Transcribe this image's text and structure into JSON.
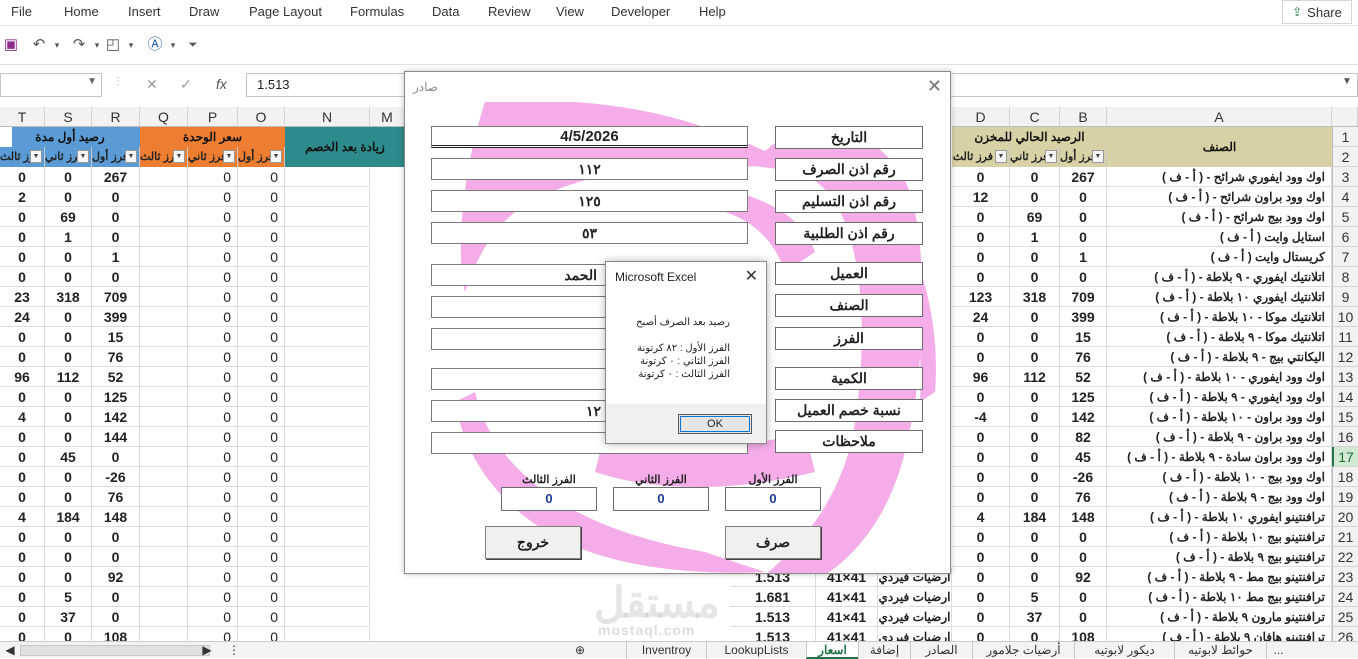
{
  "ribbon": {
    "tabs": [
      "File",
      "Home",
      "Insert",
      "Draw",
      "Page Layout",
      "Formulas",
      "Data",
      "Review",
      "View",
      "Developer",
      "Help"
    ],
    "share_label": "Share"
  },
  "formula_bar": {
    "name_box": "",
    "fx": "fx",
    "value": "1.513"
  },
  "columns_left": [
    "T",
    "S",
    "R",
    "Q",
    "P",
    "O",
    "N",
    "M"
  ],
  "columns_right": [
    "D",
    "C",
    "B",
    "A"
  ],
  "rows": [
    "1",
    "2",
    "3",
    "4",
    "5",
    "6",
    "7",
    "8",
    "9",
    "10",
    "11",
    "12",
    "13",
    "14",
    "15",
    "16",
    "17",
    "18",
    "19",
    "20",
    "21",
    "22",
    "23",
    "24",
    "25",
    "26"
  ],
  "active_row": "17",
  "headers": {
    "opening_balance": "رصيد أول مدة",
    "unit_price": "سعر الوحدة",
    "increase": "زيادة بعد الخصم",
    "increase_n": "زيادة بعد الخصم",
    "current_balance": "الرصيد الحالي للمخزن",
    "item": "الصنف",
    "sort1": "فرز أول",
    "sort2": "فرز ثاني",
    "sort3": "فرز ثالث"
  },
  "items": [
    "اوك وود ايفوري شرائح - ( أ - ف )",
    "اوك وود براون شرائح - ( أ - ف )",
    "اوك وود بيج شرائح - ( أ - ف )",
    "استايل وايت ( أ - ف )",
    "كريستال وايت ( أ - ف )",
    "اتلانتيك ايفوري - ٩ بلاطة - ( أ - ف )",
    "اتلانتيك ايفوري ١٠ بلاطة - ( أ - ف )",
    "اتلانتيك موكا - ١٠ بلاطة - ( أ - ف )",
    "اتلانتيك موكا - ٩ بلاطة - ( أ - ف )",
    "اليكانتي بيج - ٩ بلاطة - ( أ - ف )",
    "اوك وود ايفوري - ١٠ بلاطة - ( أ - ف )",
    "اوك وود ايفوري - ٩ بلاطة - ( أ - ف )",
    "اوك وود براون - ١٠ بلاطة - ( أ - ف )",
    "اوك وود براون - ٩ بلاطة - ( أ - ف )",
    "اوك وود براون سادة - ٩ بلاطة - ( أ - ف )",
    "اوك وود بيج - ١٠ بلاطة - ( أ - ف )",
    "اوك وود بيج - ٩ بلاطة - ( أ - ف )",
    "ترافنتينو ايفوري ١٠ بلاطة - ( أ - ف )",
    "ترافنتينو بيج ١٠ بلاطة - ( أ - ف )",
    "ترافنتينو بيج ٩ بلاطة - ( أ - ف )",
    "ترافنتينو بيج مط - ٩ بلاطة - ( أ - ف )",
    "ترافنتينو بيج مط ١٠ بلاطة - ( أ - ف )",
    "ترافنتينو مارون ٩ بلاطة - ( أ - ف )",
    "ترافنتينو هافان ٩ بلاطة - ( أ - ف )"
  ],
  "col_B": [
    "267",
    "0",
    "0",
    "0",
    "1",
    "0",
    "709",
    "399",
    "15",
    "76",
    "52",
    "125",
    "142",
    "82",
    "45",
    "-26",
    "76",
    "148",
    "0",
    "0",
    "92",
    "0",
    "0",
    "108"
  ],
  "col_C": [
    "0",
    "0",
    "69",
    "1",
    "0",
    "0",
    "318",
    "0",
    "0",
    "0",
    "112",
    "0",
    "0",
    "0",
    "0",
    "0",
    "0",
    "184",
    "0",
    "0",
    "0",
    "5",
    "37",
    "0"
  ],
  "col_D": [
    "0",
    "12",
    "0",
    "0",
    "0",
    "0",
    "123",
    "24",
    "0",
    "0",
    "96",
    "0",
    "-4",
    "0",
    "0",
    "0",
    "0",
    "4",
    "0",
    "0",
    "0",
    "0",
    "0",
    "0"
  ],
  "col_R": [
    "267",
    "0",
    "0",
    "0",
    "1",
    "0",
    "709",
    "399",
    "15",
    "76",
    "52",
    "125",
    "142",
    "144",
    "0",
    "-26",
    "76",
    "148",
    "0",
    "0",
    "92",
    "0",
    "0",
    "108"
  ],
  "col_S": [
    "0",
    "0",
    "69",
    "1",
    "0",
    "0",
    "318",
    "0",
    "0",
    "0",
    "112",
    "0",
    "0",
    "0",
    "45",
    "0",
    "0",
    "184",
    "0",
    "0",
    "0",
    "5",
    "37",
    "0"
  ],
  "col_T": [
    "0",
    "2",
    "0",
    "0",
    "0",
    "0",
    "23",
    "24",
    "0",
    "0",
    "96",
    "0",
    "4",
    "0",
    "0",
    "0",
    "0",
    "4",
    "0",
    "0",
    "0",
    "0",
    "0",
    "0"
  ],
  "col_P": [
    "0",
    "0",
    "0",
    "0",
    "0",
    "0",
    "0",
    "0",
    "0",
    "0",
    "0",
    "0",
    "0",
    "0",
    "0",
    "0",
    "0",
    "0",
    "0",
    "0",
    "0",
    "0",
    "0",
    "0"
  ],
  "col_O": [
    "0",
    "0",
    "0",
    "0",
    "0",
    "0",
    "0",
    "0",
    "0",
    "0",
    "0",
    "0",
    "0",
    "0",
    "0",
    "0",
    "0",
    "0",
    "0",
    "0",
    "0",
    "0",
    "0",
    "0"
  ],
  "bottom_rows": [
    {
      "price": "1.513",
      "size": "41×41",
      "type": "ارضيات فيردي"
    },
    {
      "price": "1.681",
      "size": "41×41",
      "type": "ارضيات فيردي"
    },
    {
      "price": "1.513",
      "size": "41×41",
      "type": "ارضيات فيردي"
    },
    {
      "price": "1.513",
      "size": "41×41",
      "type": "ارضيات فيردي"
    }
  ],
  "sheet_tabs": [
    "Inventroy",
    "LookupLists",
    "اسعار",
    "إضافة",
    "الصادر",
    "أرضيات جلامور",
    "ديكور لابوتيه",
    "حوائط لابوتيه",
    "..."
  ],
  "active_sheet": "اسعار",
  "form": {
    "title": "صادر",
    "labels": {
      "date": "التاريخ",
      "issue_no": "رقم اذن الصرف",
      "delivery_no": "رقم اذن التسليم",
      "request_no": "رقم اذن الطلبية",
      "customer": "العميل",
      "item": "الصنف",
      "sort": "الفرز",
      "quantity": "الكمية",
      "discount": "نسبة خصم العميل",
      "notes": "ملاحظات"
    },
    "values": {
      "date": "4/5/2026",
      "issue_no": "١١٢",
      "delivery_no": "١٢٥",
      "request_no": "٥٣",
      "customer": "الحمد",
      "item": "",
      "sort": "",
      "quantity": "",
      "discount": "١٢",
      "notes": ""
    },
    "sub_labels": {
      "first": "الفرز الأول",
      "second": "الفرز الثاني",
      "third": "الفرز الثالث"
    },
    "sub_values": {
      "first": "0",
      "second": "0",
      "third": "0"
    },
    "buttons": {
      "issue": "صرف",
      "exit": "خروج"
    }
  },
  "msgbox": {
    "title": "Microsoft Excel",
    "line1": "رصيد   بعد الصرف أصبح",
    "line2": "الفرز الأول : ٨٢  كرتونة",
    "line3": "الفرز الثاني : ٠  كرتونة",
    "line4": "الفرز الثالث : ٠  كرتونة",
    "ok": "OK"
  },
  "watermark": {
    "ar": "مستقل",
    "en": "mostaql.com"
  },
  "colors": {
    "header_gold": "#d8d1a6",
    "header_blue": "#5b9bd5",
    "header_orange": "#ed7d31",
    "header_teal": "#2e8b8b",
    "form_pink": "#f4a9e7",
    "excel_green": "#217346"
  }
}
